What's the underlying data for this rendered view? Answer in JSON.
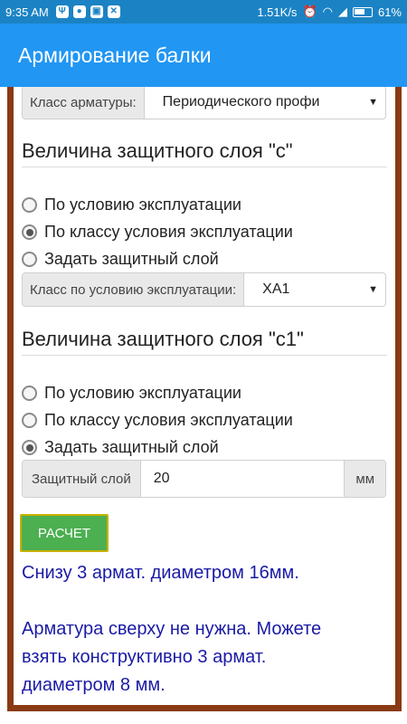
{
  "status_bar": {
    "time": "9:35 AM",
    "network_speed": "1.51K/s",
    "battery": "61%",
    "icons": [
      "usb-icon",
      "app-icon",
      "gallery-icon",
      "store-icon",
      "alarm-icon",
      "wifi-icon",
      "signal-icon",
      "battery-icon"
    ]
  },
  "app_bar": {
    "title": "Армирование балки"
  },
  "form": {
    "rebar_class": {
      "label": "Класс арматуры:",
      "value": "Периодического профи"
    },
    "section_c": {
      "title": "Величина защитного слоя \"c\"",
      "options": [
        "По условию эксплуатации",
        "По классу условия эксплуатации",
        "Задать защитный слой"
      ],
      "selected_index": 1,
      "class_select": {
        "label": "Класс по условию эксплуатации:",
        "value": "XA1"
      }
    },
    "section_c1": {
      "title": "Величина защитного слоя \"c1\"",
      "options": [
        "По условию эксплуатации",
        "По классу условия эксплуатации",
        "Задать защитный слой"
      ],
      "selected_index": 2,
      "layer_input": {
        "label": "Защитный слой",
        "value": "20",
        "unit": "мм"
      }
    },
    "calc_button": "РАСЧЕТ"
  },
  "results": {
    "bottom": "Снизу 3 армат. диаметром 16мм.",
    "top_line1": "Арматура сверху не нужна. Можете",
    "top_line2": "взять конструктивно 3 армат.",
    "top_line3": "диаметром 8 мм."
  },
  "colors": {
    "app_bar": "#2196f3",
    "status_bar": "#1b83c4",
    "frame": "#8a3a13",
    "button": "#4caf50",
    "result_text": "#1a1aa6"
  }
}
